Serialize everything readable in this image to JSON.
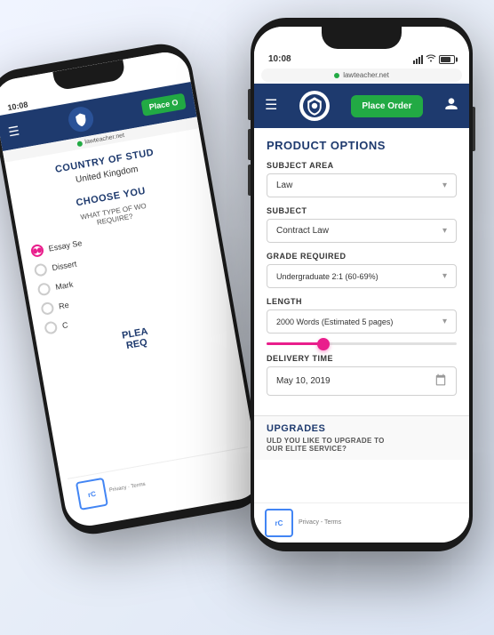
{
  "back_phone": {
    "status_time": "10:08",
    "url": "lawteacher.net",
    "country_title": "COUNTRY OF STUD",
    "country_value": "United Kingdom",
    "choose_title": "CHOOSE YOU",
    "what_type": "WHAT TYPE OF WO",
    "require_label": "REQUIRE?",
    "radio_items": [
      {
        "label": "Essay Se",
        "active": true
      },
      {
        "label": "Dissert",
        "active": false
      },
      {
        "label": "Mark",
        "active": false
      },
      {
        "label": "Re",
        "active": false
      },
      {
        "label": "C",
        "active": false
      }
    ],
    "please_label": "PLEA",
    "req_label": "REQ",
    "place_order_label": "Place O",
    "menu_label": "☰"
  },
  "front_phone": {
    "status_time": "10:08",
    "url": "lawteacher.net",
    "nav": {
      "menu_label": "☰",
      "place_order_label": "Place Order",
      "user_icon": "👤"
    },
    "content": {
      "section_title": "PRODUCT OPTIONS",
      "subject_area_label": "SUBJECT AREA",
      "subject_area_value": "Law",
      "subject_label": "SUBJECT",
      "subject_value": "Contract Law",
      "grade_label": "GRADE REQUIRED",
      "grade_value": "Undergraduate 2:1 (60-69%)",
      "length_label": "LENGTH",
      "length_value": "2000 Words (Estimated 5 pages)",
      "slider_percent": 30,
      "delivery_label": "DELIVERY TIME",
      "delivery_value": "May 10, 2019"
    },
    "upgrades": {
      "title": "UPGRADES",
      "subtitle": "ULD YOU LIKE TO UPGRADE TO",
      "sub2": "OUR ELITE SERVICE?"
    },
    "recaptcha_text": "Privacy - Terms"
  }
}
